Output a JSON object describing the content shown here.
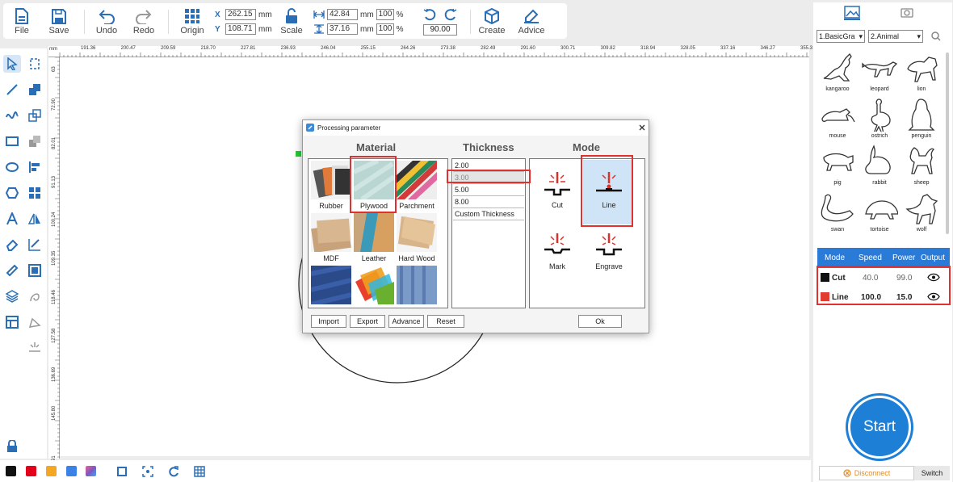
{
  "toolbar": {
    "file": "File",
    "save": "Save",
    "undo": "Undo",
    "redo": "Redo",
    "origin": "Origin",
    "scale": "Scale",
    "create": "Create",
    "advice": "Advice",
    "x_label": "X",
    "y_label": "Y",
    "x_value": "262.15",
    "y_value": "108.71",
    "width_value": "42.84",
    "height_value": "37.16",
    "width_pct": "100",
    "height_pct": "100",
    "unit": "mm",
    "pct": "%",
    "rotation": "90.00"
  },
  "ruler": {
    "unit": "mm",
    "top_ticks": [
      "191.36",
      "200.47",
      "209.59",
      "218.70",
      "227.81",
      "236.93",
      "246.04",
      "255.15",
      "264.26",
      "273.38",
      "282.49",
      "291.60",
      "300.71",
      "309.82",
      "318.94",
      "328.05",
      "337.16",
      "346.27",
      "355.3"
    ],
    "left_ticks": [
      "63",
      "72.90",
      "82.01",
      "91.13",
      "100.24",
      "109.35",
      "118.46",
      "127.58",
      "136.69",
      "145.80",
      "91"
    ]
  },
  "dialog": {
    "title": "Processing parameter",
    "material_header": "Material",
    "thickness_header": "Thickness",
    "mode_header": "Mode",
    "materials": [
      "Rubber",
      "Plywood",
      "Parchment",
      "MDF",
      "Leather",
      "Hard Wood"
    ],
    "thicknesses": [
      "2.00",
      "3.00",
      "5.00",
      "8.00",
      "Custom Thickness"
    ],
    "modes": [
      "Cut",
      "Line",
      "Mark",
      "Engrave"
    ],
    "buttons": {
      "import": "Import",
      "export": "Export",
      "advance": "Advance",
      "reset": "Reset",
      "ok": "Ok"
    },
    "selected_material": "Plywood",
    "selected_thickness": "3.00",
    "selected_mode": "Line"
  },
  "right_panel": {
    "category": "1.BasicGra",
    "subcategory": "2.Animal",
    "shapes": [
      "kangaroo",
      "leopard",
      "lion",
      "mouse",
      "ostrich",
      "penguin",
      "pig",
      "rabbit",
      "sheep",
      "swan",
      "tortoise",
      "wolf"
    ]
  },
  "layers": {
    "headers": [
      "Mode",
      "Speed",
      "Power",
      "Output"
    ],
    "rows": [
      {
        "mode": "Cut",
        "speed": "40.0",
        "power": "99.0",
        "color": "#111111"
      },
      {
        "mode": "Line",
        "speed": "100.0",
        "power": "15.0",
        "color": "#e03c31"
      }
    ]
  },
  "bottom": {
    "start": "Start",
    "disconnect": "Disconnect",
    "switch": "Switch",
    "swatches": [
      "#111111",
      "#e3001b",
      "#f5a623",
      "#3b82e6",
      "#e86ab0"
    ]
  },
  "colors": {
    "accent": "#1e7fd6",
    "highlight": "#e03030"
  }
}
